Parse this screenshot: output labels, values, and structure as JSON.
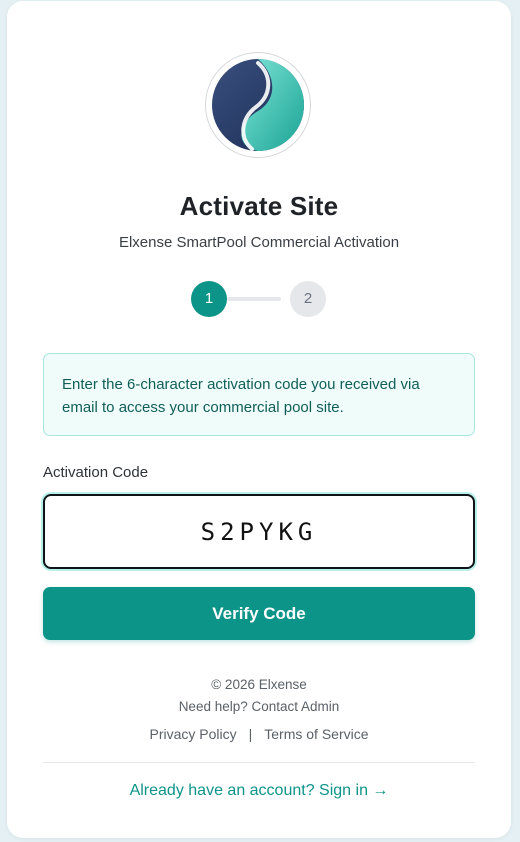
{
  "header": {
    "title": "Activate Site",
    "subtitle": "Elxense SmartPool Commercial Activation"
  },
  "stepper": {
    "current": 1,
    "steps": [
      {
        "label": "1"
      },
      {
        "label": "2"
      }
    ]
  },
  "info": {
    "text": "Enter the 6-character activation code you received via email to access your commercial pool site."
  },
  "form": {
    "code_label": "Activation Code",
    "code_value": "S2PYKG",
    "submit_label": "Verify Code"
  },
  "footer": {
    "copyright": "© 2026 Elxense",
    "help_text": "Need help? Contact Admin",
    "privacy_link": "Privacy Policy",
    "separator": "|",
    "terms_link": "Terms of Service",
    "signin_link": "Already have an account? Sign in →"
  },
  "colors": {
    "accent": "#0d9488",
    "info_bg": "#effcfa",
    "info_border": "#a8e6dd",
    "step_inactive": "#e5e7eb"
  },
  "icons": {
    "logo": "elxense-logo-icon"
  }
}
